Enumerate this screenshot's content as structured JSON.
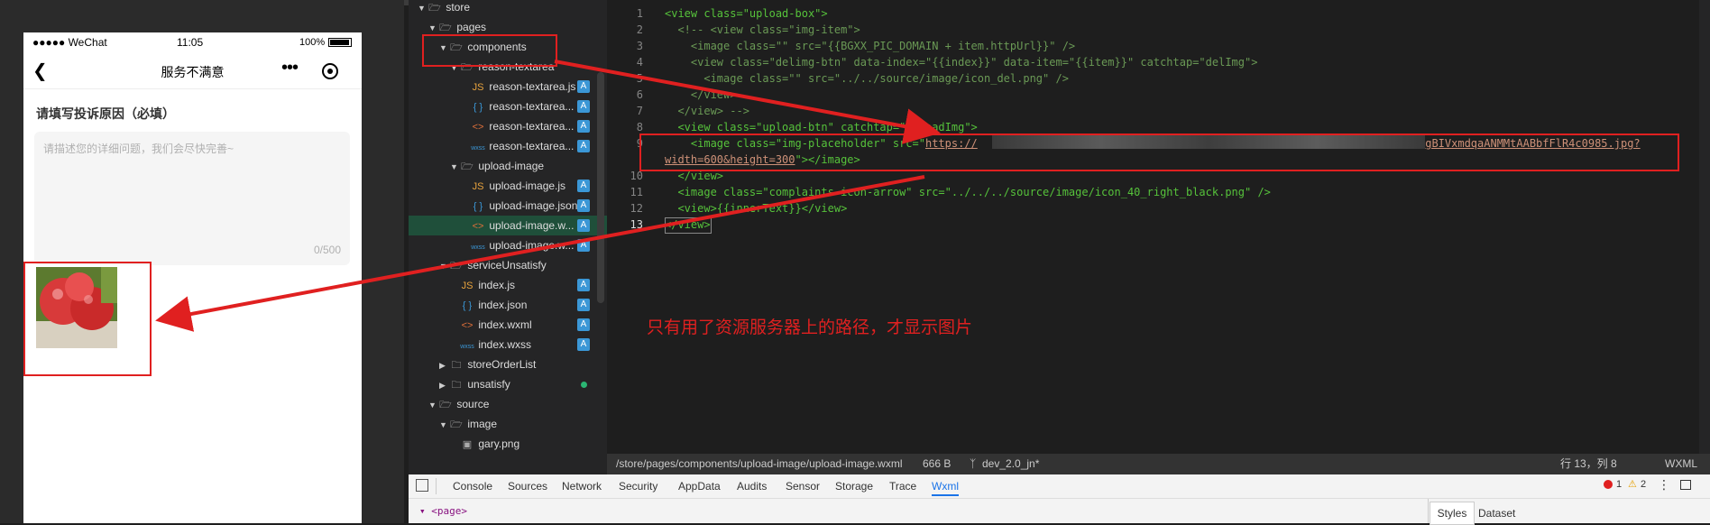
{
  "phone": {
    "carrier": "●●●●● WeChat",
    "time": "11:05",
    "battery": "100%",
    "title": "服务不满意",
    "reason_title": "请填写投诉原因（必填）",
    "textarea_placeholder": "请描述您的详细问题，我们会尽快完善~",
    "counter": "0/500"
  },
  "explorer": {
    "items": [
      {
        "label": "store",
        "type": "folder",
        "open": true
      },
      {
        "label": "pages",
        "type": "folder",
        "open": true
      },
      {
        "label": "components",
        "type": "folder",
        "open": true
      },
      {
        "label": "reason-textarea",
        "type": "folder",
        "open": true
      },
      {
        "label": "reason-textarea.js",
        "type": "js",
        "badge": "A"
      },
      {
        "label": "reason-textarea...",
        "type": "json",
        "badge": "A"
      },
      {
        "label": "reason-textarea...",
        "type": "wxml",
        "badge": "A"
      },
      {
        "label": "reason-textarea...",
        "type": "wxss",
        "badge": "A"
      },
      {
        "label": "upload-image",
        "type": "folder",
        "open": true
      },
      {
        "label": "upload-image.js",
        "type": "js",
        "badge": "A"
      },
      {
        "label": "upload-image.json",
        "type": "json",
        "badge": "A"
      },
      {
        "label": "upload-image.w...",
        "type": "wxml",
        "badge": "A",
        "selected": true
      },
      {
        "label": "upload-image.w...",
        "type": "wxss",
        "badge": "A"
      },
      {
        "label": "serviceUnsatisfy",
        "type": "folder",
        "open": true
      },
      {
        "label": "index.js",
        "type": "js",
        "badge": "A"
      },
      {
        "label": "index.json",
        "type": "json",
        "badge": "A"
      },
      {
        "label": "index.wxml",
        "type": "wxml",
        "badge": "A"
      },
      {
        "label": "index.wxss",
        "type": "wxss",
        "badge": "A"
      },
      {
        "label": "storeOrderList",
        "type": "folder",
        "open": false
      },
      {
        "label": "unsatisfy",
        "type": "folder",
        "open": false,
        "dot": true
      },
      {
        "label": "source",
        "type": "folder",
        "open": true
      },
      {
        "label": "image",
        "type": "folder",
        "open": true
      },
      {
        "label": "gary.png",
        "type": "png"
      }
    ]
  },
  "editor": {
    "line_numbers": [
      "1",
      "2",
      "3",
      "4",
      "5",
      "6",
      "7",
      "8",
      "9",
      "",
      "10",
      "11",
      "12",
      "13"
    ],
    "line1": "<view class=\"upload-box\">",
    "line2": "  <!-- <view class=\"img-item\">",
    "line3": "    <image class=\"\" src=\"{{BGXX_PIC_DOMAIN + item.httpUrl}}\" />",
    "line4": "    <view class=\"delimg-btn\" data-index=\"{{index}}\" data-item=\"{{item}}\" catchtap=\"delImg\">",
    "line5": "      <image class=\"\" src=\"../../source/image/icon_del.png\" />",
    "line6": "    </view>",
    "line7": "  </view> -->",
    "line8": "  <view class=\"upload-btn\" catchtap=\"uploadImg\">",
    "line9a_prefix": "    <image class=\"img-placeholder\" src=\"",
    "line9a_url": "https://",
    "line9a_url_tail": "KgBIVxmdqaANMMtAABbfFlR4c0985.jpg?",
    "line9b_url": "width=600&height=300",
    "line9b_suffix": "\"></image>",
    "line10": "  </view>",
    "line11": "  <image class=\"complaints-icon-arrow\" src=\"../../../source/image/icon_40_right_black.png\" />",
    "line12": "  <view>{{innerText}}</view>",
    "line13": "</view>",
    "annotation": "只有用了资源服务器上的路径，才显示图片"
  },
  "statusbar": {
    "path": "/store/pages/components/upload-image/upload-image.wxml",
    "size": "666 B",
    "branch": "dev_2.0_jn*",
    "position": "行 13，列 8",
    "language": "WXML"
  },
  "devtools": {
    "tabs": [
      "Console",
      "Sources",
      "Network",
      "Security",
      "AppData",
      "Audits",
      "Sensor",
      "Storage",
      "Trace",
      "Wxml"
    ],
    "active_tab": "Wxml",
    "errors": "1",
    "warnings": "2",
    "page_node": "▾ <page>",
    "styles_tab": "Styles",
    "dataset_tab": "Dataset"
  },
  "colors": {
    "highlight": "#e02020",
    "tag": "#56c23b",
    "badge": "#3b97d6"
  }
}
